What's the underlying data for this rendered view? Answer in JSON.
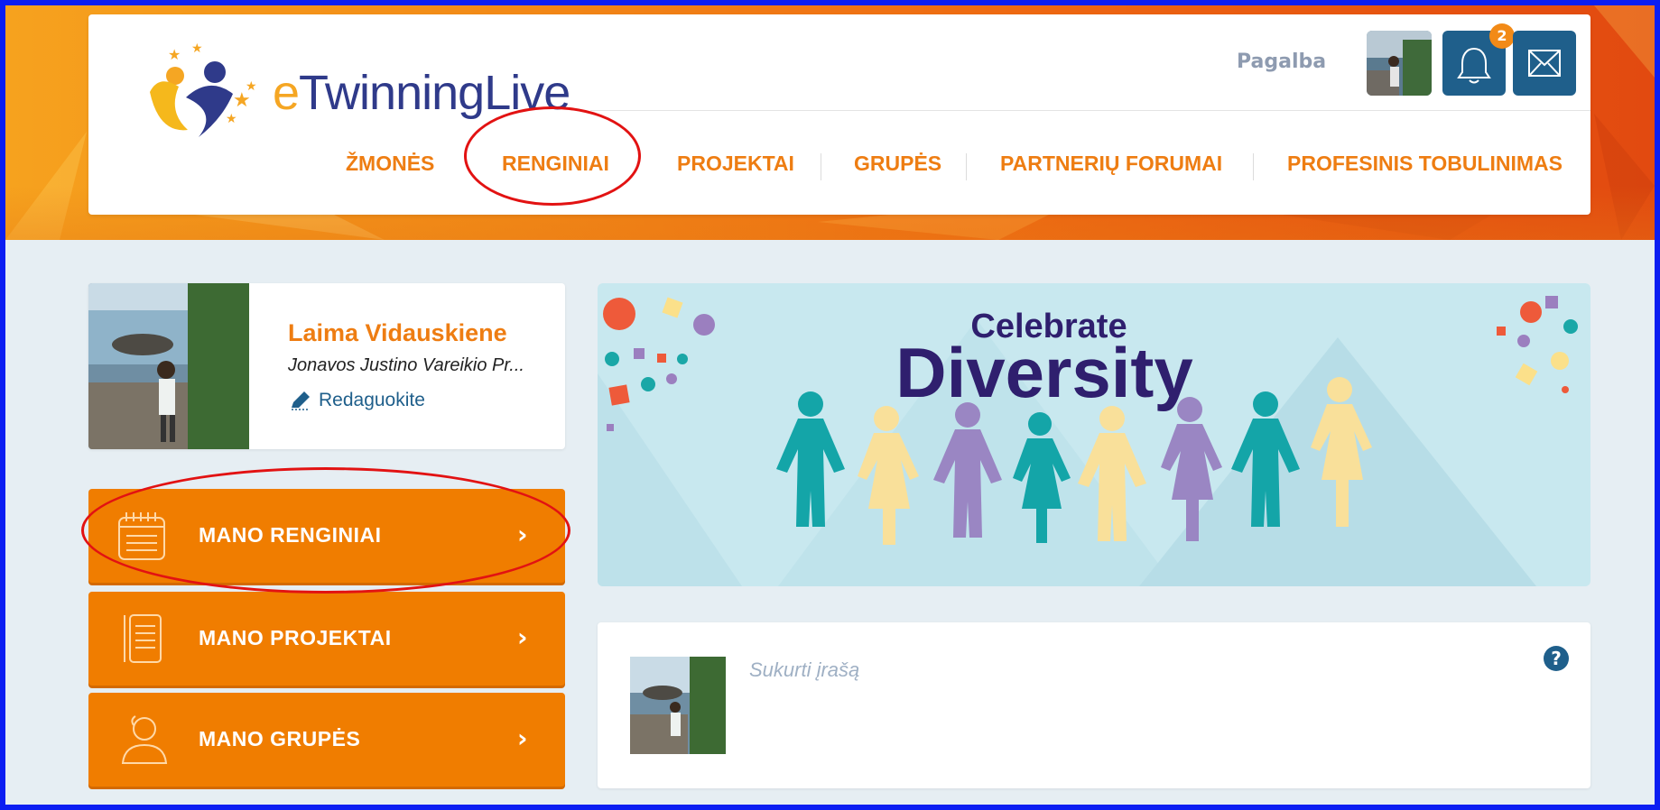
{
  "header": {
    "logo_prefix": "e",
    "logo_main": "Twinning",
    "logo_suffix": "Live",
    "help_label": "Pagalba",
    "notification_count": "2",
    "nav": [
      {
        "label": "ŽMONĖS"
      },
      {
        "label": "RENGINIAI"
      },
      {
        "label": "PROJEKTAI"
      },
      {
        "label": "GRUPĖS"
      },
      {
        "label": "PARTNERIŲ FORUMAI"
      },
      {
        "label": "PROFESINIS TOBULINIMAS"
      }
    ]
  },
  "profile": {
    "name": "Laima Vidauskiene",
    "school": "Jonavos Justino Vareikio Pr...",
    "edit_label": "Redaguokite"
  },
  "sidebar": {
    "buttons": [
      {
        "label": "MANO RENGINIAI",
        "icon": "calendar-icon"
      },
      {
        "label": "MANO PROJEKTAI",
        "icon": "document-icon"
      },
      {
        "label": "MANO GRUPĖS",
        "icon": "users-icon"
      }
    ],
    "chevron": "›"
  },
  "banner": {
    "line1": "Celebrate",
    "line2": "Diversity"
  },
  "post": {
    "placeholder": "Sukurti įrašą",
    "help_symbol": "?"
  },
  "colors": {
    "accent_orange": "#f07d00",
    "nav_orange": "#ee7d12",
    "brand_blue": "#1f5f8b",
    "annotation_red": "#e21212",
    "frame_blue": "#0b1ef2"
  }
}
